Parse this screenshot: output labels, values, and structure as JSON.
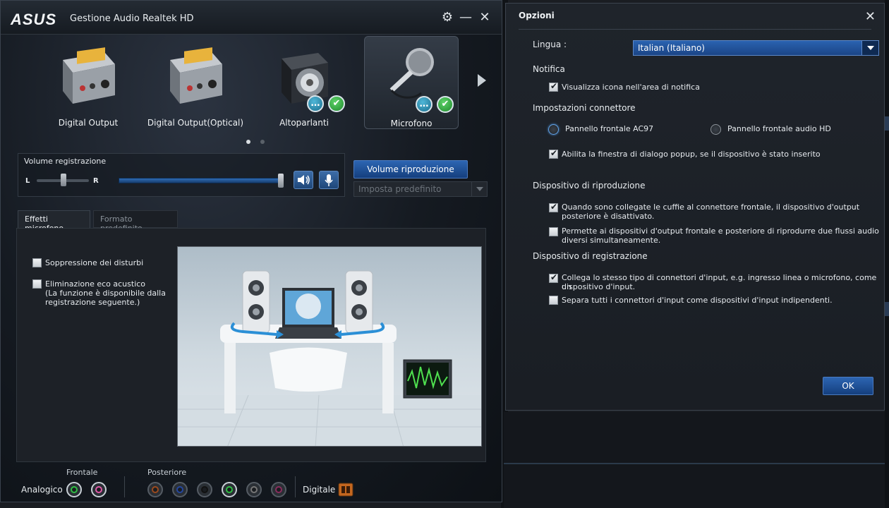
{
  "main_window": {
    "brand": "ASUS",
    "title": "Gestione Audio Realtek HD",
    "devices": [
      {
        "label": "Digital Output"
      },
      {
        "label": "Digital Output(Optical)"
      },
      {
        "label": "Altoparlanti"
      },
      {
        "label": "Microfono"
      }
    ],
    "volume": {
      "title": "Volume registrazione",
      "left_label": "L",
      "right_label": "R",
      "level_percent": 100,
      "balance_percent": 50
    },
    "playback_volume_button": "Volume riproduzione",
    "set_default_dropdown": "Imposta predefinito",
    "tabs": [
      {
        "label": "Effetti microfono",
        "active": true
      },
      {
        "label": "Formato predefinito",
        "active": false
      }
    ],
    "effects": {
      "noise_suppression": "Soppressione dei disturbi",
      "echo_cancel_line1": "Eliminazione eco acustico",
      "echo_cancel_line2": "(La funzione è disponibile dalla",
      "echo_cancel_line3": "registrazione seguente.)"
    },
    "jacks": {
      "front_label": "Frontale",
      "rear_label": "Posteriore",
      "analog_label": "Analogico",
      "digital_label": "Digitale"
    }
  },
  "options_dialog": {
    "title": "Opzioni",
    "language_label": "Lingua :",
    "language_value": "Italian (Italiano)",
    "notification_section": "Notifica",
    "notification_option": "Visualizza icona nell'area di notifica",
    "connector_section": "Impostazioni connettore",
    "radio_ac97": "Pannello frontale AC97",
    "radio_hd": "Pannello frontale audio HD",
    "popup_option": "Abilita la finestra di dialogo popup, se il dispositivo è stato inserito",
    "playback_section": "Dispositivo di riproduzione",
    "playback_opt1_line1": "Quando sono collegate le cuffie al connettore frontale, il dispositivo d'output",
    "playback_opt1_line2": "posteriore è disattivato.",
    "playback_opt2_line1": "Permette ai dispositivi d'output frontale e posteriore di riprodurre due flussi audio",
    "playback_opt2_line2": "diversi simultaneamente.",
    "recording_section": "Dispositivo di registrazione",
    "recording_opt1_line1": "Collega lo stesso tipo di connettori d'input, e.g. ingresso linea o microfono, come un",
    "recording_opt1_line2": "dispositivo d'input.",
    "recording_opt2": "Separa tutti i connettori d'input come dispositivi d'input indipendenti.",
    "ok_button": "OK"
  },
  "colors": {
    "accent_blue": "#2d65b2",
    "check_green": "#2fa53b",
    "jack_green": "#2fbf44",
    "jack_pink": "#e05aa8"
  }
}
